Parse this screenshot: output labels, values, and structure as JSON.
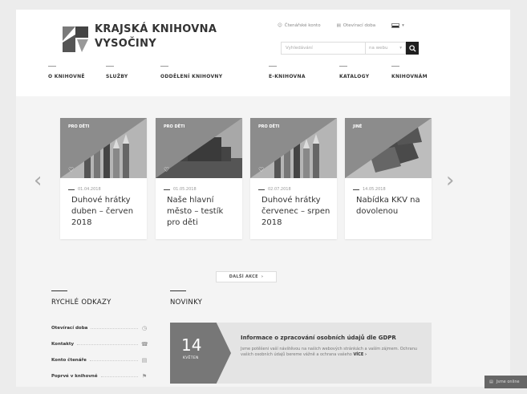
{
  "header": {
    "logo_line1": "KRAJSKÁ KNIHOVNA",
    "logo_line2": "VYSOČINY",
    "reader_account": "Čtenářské konto",
    "opening_hours": "Otevírací doba",
    "search_placeholder": "Vyhledávání",
    "search_scope": "na webu"
  },
  "nav": {
    "items": [
      "O KNIHOVNĚ",
      "SLUŽBY",
      "ODDĚLENÍ KNIHOVNY",
      "E-KNIHOVNA",
      "KATALOGY",
      "KNIHOVNÁM"
    ]
  },
  "events": [
    {
      "badge": "PRO DĚTI",
      "date": "01.04.2018",
      "title": "Duhové hrátky duben – červen 2018",
      "icon": "pencils-image"
    },
    {
      "badge": "PRO DĚTI",
      "date": "01.05.2018",
      "title": "Naše hlavní město – testík pro děti",
      "icon": "prague-castle-image"
    },
    {
      "badge": "PRO DĚTI",
      "date": "02.07.2018",
      "title": "Duhové hrátky červenec – srpen 2018",
      "icon": "pencils-image"
    },
    {
      "badge": "JINÉ",
      "date": "14.05.2018",
      "title": "Nabídka KKV na dovolenou",
      "icon": "travel-photos-image"
    }
  ],
  "more_events": "DALŠÍ AKCE",
  "quick_links": {
    "title": "RYCHLÉ ODKAZY",
    "items": [
      {
        "label": "Otevírací doba",
        "icon": "clock-icon"
      },
      {
        "label": "Kontakty",
        "icon": "contact-icon"
      },
      {
        "label": "Konto čtenáře",
        "icon": "book-icon"
      },
      {
        "label": "Poprvé v knihovně",
        "icon": "pin-icon"
      }
    ]
  },
  "news": {
    "title": "NOVINKY",
    "day": "14",
    "month": "KVĚTEN",
    "headline": "Informace o zpracování osobních údajů dle GDPR",
    "text": "Jsme potěšeni vaší návštěvou na našich webových stránkách a vaším zájmem. Ochranu vašich osobních údajů bereme vážně a ochrana vašeho",
    "more": "VÍCE"
  },
  "chat": {
    "label": "Jsme online"
  },
  "colors": {
    "accent": "#1f1f1f",
    "badge": "#8c8c8c",
    "news_bg": "#e4e4e4"
  }
}
